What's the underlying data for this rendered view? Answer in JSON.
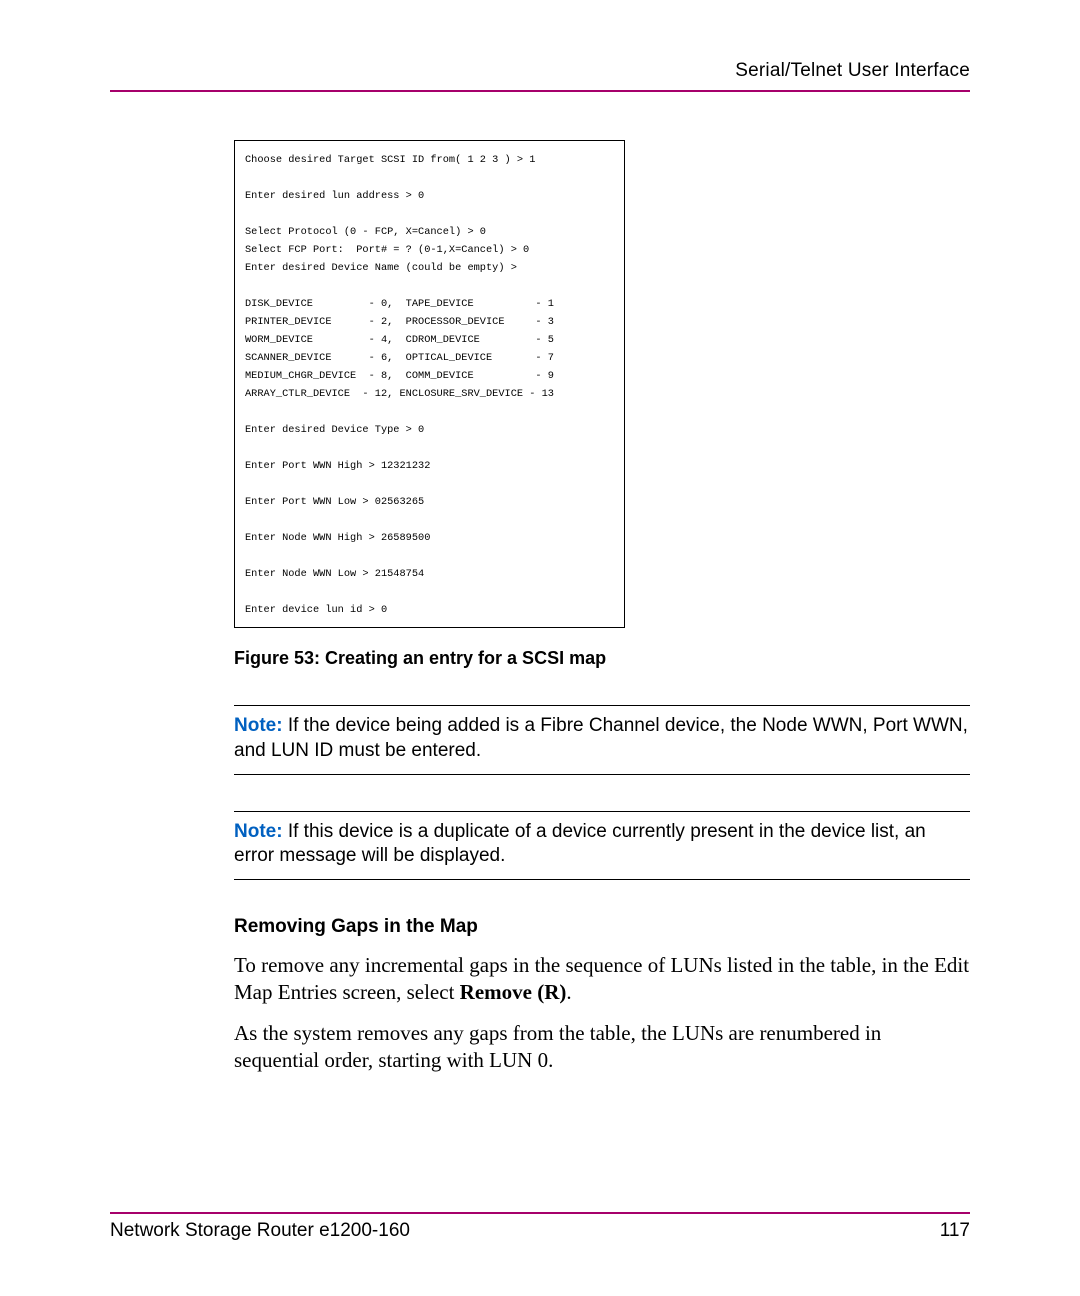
{
  "header": {
    "running_title": "Serial/Telnet User Interface"
  },
  "terminal": {
    "lines": "Choose desired Target SCSI ID from( 1 2 3 ) > 1\n\nEnter desired lun address > 0\n\nSelect Protocol (0 - FCP, X=Cancel) > 0\nSelect FCP Port:  Port# = ? (0-1,X=Cancel) > 0\nEnter desired Device Name (could be empty) >\n\nDISK_DEVICE         - 0,  TAPE_DEVICE          - 1\nPRINTER_DEVICE      - 2,  PROCESSOR_DEVICE     - 3\nWORM_DEVICE         - 4,  CDROM_DEVICE         - 5\nSCANNER_DEVICE      - 6,  OPTICAL_DEVICE       - 7\nMEDIUM_CHGR_DEVICE  - 8,  COMM_DEVICE          - 9\nARRAY_CTLR_DEVICE  - 12, ENCLOSURE_SRV_DEVICE - 13\n\nEnter desired Device Type > 0\n\nEnter Port WWN High > 12321232\n\nEnter Port WWN Low > 02563265\n\nEnter Node WWN High > 26589500\n\nEnter Node WWN Low > 21548754\n\nEnter device lun id > 0"
  },
  "caption": "Figure 53:  Creating an entry for a SCSI map",
  "notes": [
    {
      "label": "Note:",
      "text": "  If the device being added is a Fibre Channel device, the Node WWN, Port WWN, and LUN ID must be entered."
    },
    {
      "label": "Note:",
      "text": "  If this device is a duplicate of a device currently present in the device list, an error message will be displayed."
    }
  ],
  "section": {
    "heading": "Removing Gaps in the Map",
    "p1_a": "To remove any incremental gaps in the sequence of LUNs listed in the table, in the Edit Map Entries screen, select ",
    "p1_b": "Remove (R)",
    "p1_c": ".",
    "p2": "As the system removes any gaps from the table, the LUNs are renumbered in sequential order, starting with LUN 0."
  },
  "footer": {
    "doc_title": "Network Storage Router e1200-160",
    "page_number": "117"
  }
}
